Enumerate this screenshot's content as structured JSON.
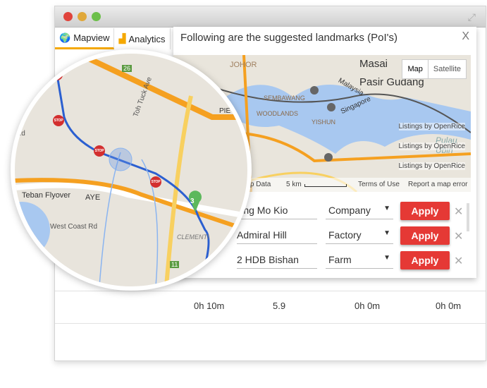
{
  "window": {
    "tabs": [
      {
        "label": "Mapview",
        "icon": "globe-pin-icon"
      },
      {
        "label": "Analytics",
        "icon": "bar-chart-icon"
      }
    ]
  },
  "table": {
    "rows": [
      [
        "0h 10m",
        "5.9",
        "0h 0m",
        "0h 0m"
      ]
    ]
  },
  "popup": {
    "title": "Following are the suggested landmarks (PoI's)",
    "close": "X",
    "map": {
      "buttons": [
        "Map",
        "Satellite"
      ],
      "labels": [
        "Masai",
        "Pasir Gudang",
        "JOHOR",
        "SEMBAWANG",
        "WOODLANDS",
        "YISHUN",
        "Singapore",
        "Malaysia",
        "Pulau Ubin"
      ],
      "listings": [
        "Listings by OpenRice",
        "Listings by OpenRice",
        "Listings by OpenRice"
      ],
      "footer": {
        "map_data": "Map Data",
        "scale": "5 km",
        "terms": "Terms of Use",
        "report": "Report a map error"
      }
    },
    "rows": [
      {
        "name": "Ang Mo Kio",
        "type": "Company"
      },
      {
        "name": "Admiral Hill",
        "type": "Factory"
      },
      {
        "name": "2 HDB Bishan",
        "type": "Farm"
      }
    ],
    "apply_label": "Apply",
    "remove_label": "✕"
  },
  "magnifier": {
    "labels": [
      "Toh Tuck Ave",
      "Teban Flyover",
      "AYE",
      "PIE",
      "West Coast Rd",
      "CLEMENTI",
      "Rd"
    ],
    "marker": "3",
    "stop": "STOP",
    "road_numbers": [
      "26",
      "11"
    ]
  },
  "colors": {
    "accent": "#f5a800",
    "apply": "#e53935",
    "route": "#2b5fd0"
  }
}
